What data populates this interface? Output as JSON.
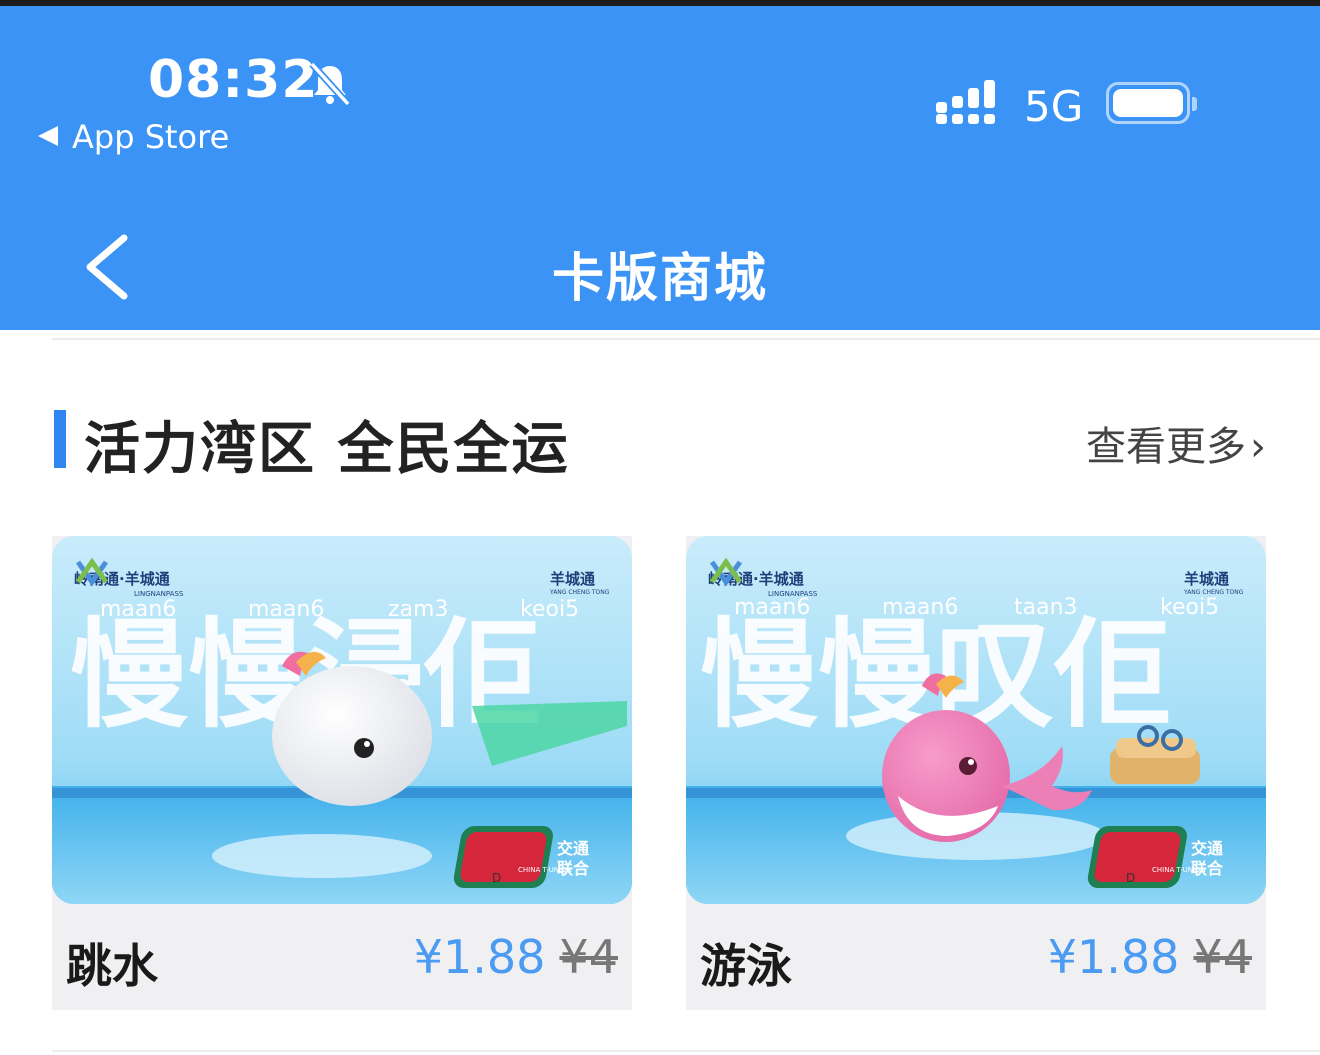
{
  "status": {
    "time": "08:32",
    "back_label": "App Store",
    "network": "5G"
  },
  "nav": {
    "title": "卡版商城"
  },
  "section": {
    "title": "活力湾区 全民全运",
    "more": "查看更多"
  },
  "cards": [
    {
      "name": "跳水",
      "price": "¥1.88",
      "original_price": "¥4",
      "brand": "岭南通·羊城通",
      "brand_sub": "LINGNANPASS",
      "brand_right": "羊城通",
      "brand_right_sub": "YANG CHENG TONG",
      "jyutping": [
        "maan6",
        "maan6",
        "zam3",
        "keoi5"
      ],
      "headline": "慢慢浸佢",
      "union_top": "交通",
      "union_bottom": "联合",
      "union_en": "CHINA T-UNION",
      "mark": "D"
    },
    {
      "name": "游泳",
      "price": "¥1.88",
      "original_price": "¥4",
      "brand": "岭南通·羊城通",
      "brand_sub": "LINGNANPASS",
      "brand_right": "羊城通",
      "brand_right_sub": "YANG CHENG TONG",
      "jyutping": [
        "maan6",
        "maan6",
        "taan3",
        "keoi5"
      ],
      "headline": "慢慢叹佢",
      "union_top": "交通",
      "union_bottom": "联合",
      "union_en": "CHINA T-UNION",
      "mark": "D"
    }
  ],
  "colors": {
    "header": "#3a93f5",
    "accent": "#2f86f0",
    "price": "#4b9bf2"
  }
}
